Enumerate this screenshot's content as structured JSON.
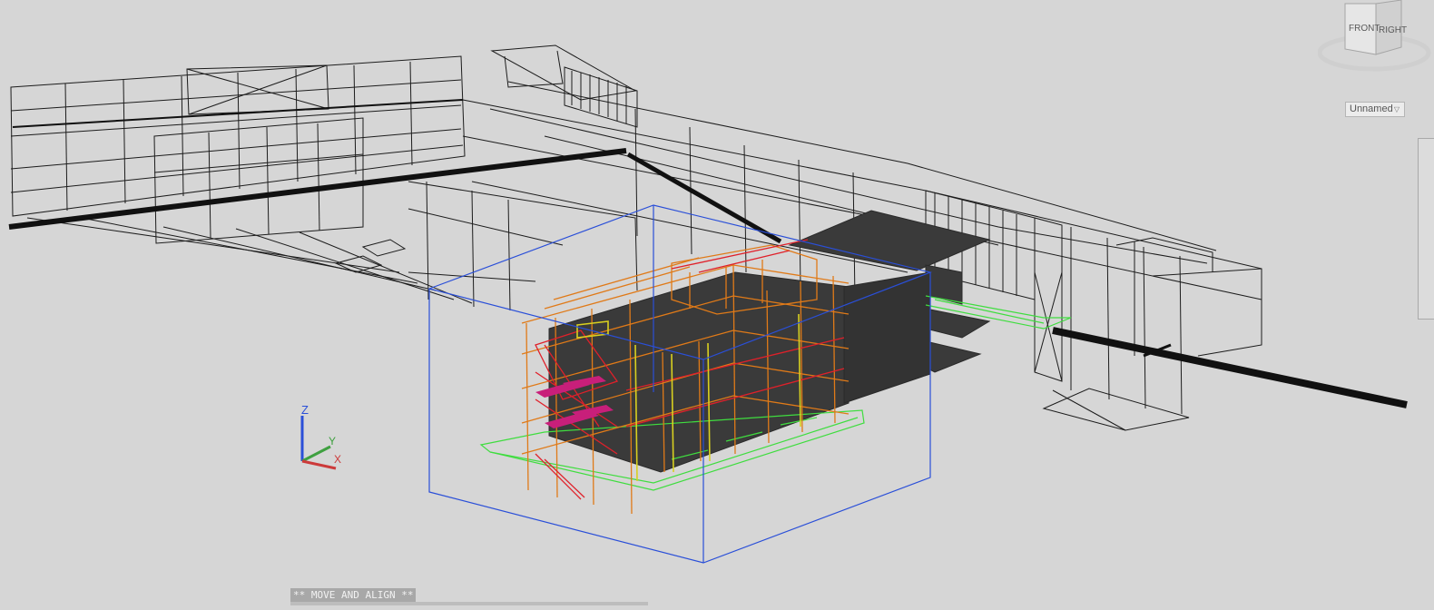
{
  "viewcube": {
    "front_label": "FRONT",
    "right_label": "RIGHT"
  },
  "view_dropdown": {
    "label": "Unnamed"
  },
  "command_line": {
    "text": "** MOVE AND ALIGN **"
  },
  "ucs_axes": {
    "x_label": "X",
    "y_label": "Y",
    "z_label": "Z"
  },
  "colors": {
    "background": "#d6d6d6",
    "wireframe": "#1a1a1a",
    "selection_box": "#2a4fd8",
    "scaffold_orange": "#e07a18",
    "scaffold_red": "#e0202a",
    "scaffold_yellow": "#d8d020",
    "footprint_green": "#3fdd3f",
    "slab_gray": "#3a3a3a"
  },
  "icons": [
    "viewcube-icon",
    "ucs-icon",
    "chevron-down-icon"
  ]
}
